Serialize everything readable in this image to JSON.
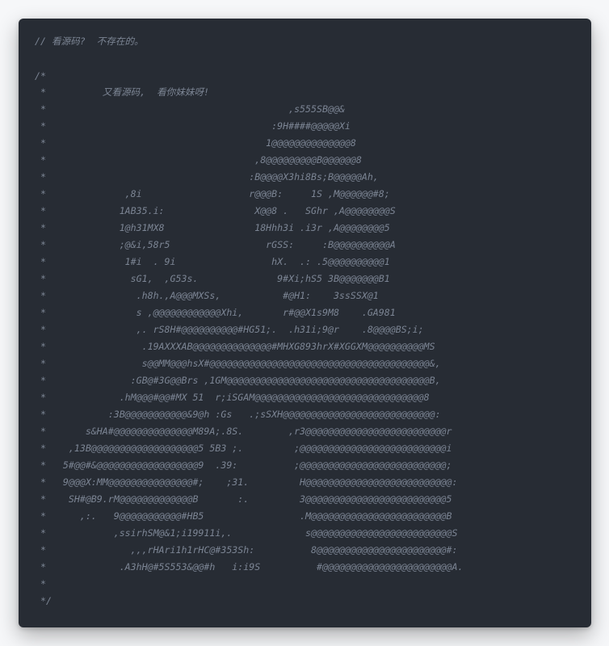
{
  "code": {
    "lines": [
      "// 看源码?  不存在的。",
      "",
      "/*",
      " *          又看源码,  看你妹妹呀!",
      " *                                           ,s555SB@@&",
      " *                                        :9H####@@@@@Xi",
      " *                                       1@@@@@@@@@@@@@@8",
      " *                                     ,8@@@@@@@@@B@@@@@@8",
      " *                                    :B@@@@X3hi8Bs;B@@@@@Ah,",
      " *              ,8i                   r@@@B:     1S ,M@@@@@@#8;",
      " *             1AB35.i:                X@@8 .   SGhr ,A@@@@@@@@S",
      " *             1@h31MX8                18Hhh3i .i3r ,A@@@@@@@@5",
      " *             ;@&i,58r5                 rGSS:     :B@@@@@@@@@@A",
      " *              1#i  . 9i                 hX.  .: .5@@@@@@@@@@1",
      " *               sG1,  ,G53s.              9#Xi;hS5 3B@@@@@@@B1",
      " *                .h8h.,A@@@MXSs,           #@H1:    3ssSSX@1",
      " *                s ,@@@@@@@@@@@@Xhi,       r#@@X1s9M8    .GA981",
      " *                ,. rS8H#@@@@@@@@@@#HG51;.  .h31i;9@r    .8@@@@BS;i;",
      " *                 .19AXXXAB@@@@@@@@@@@@@@#MHXG893hrX#XGGXM@@@@@@@@@@MS",
      " *                 s@@MM@@@hsX#@@@@@@@@@@@@@@@@@@@@@@@@@@@@@@@@@@@@@@@&,",
      " *               :GB@#3G@@Brs ,1GM@@@@@@@@@@@@@@@@@@@@@@@@@@@@@@@@@@@@B,",
      " *             .hM@@@#@@#MX 51  r;iSGAM@@@@@@@@@@@@@@@@@@@@@@@@@@@@@@8",
      " *           :3B@@@@@@@@@@@&9@h :Gs   .;sSXH@@@@@@@@@@@@@@@@@@@@@@@@@@@:",
      " *       s&HA#@@@@@@@@@@@@@@M89A;.8S.        ,r3@@@@@@@@@@@@@@@@@@@@@@@@@r",
      " *    ,13B@@@@@@@@@@@@@@@@@@@5 5B3 ;.         ;@@@@@@@@@@@@@@@@@@@@@@@@@@i",
      " *   5#@@#&@@@@@@@@@@@@@@@@@@9  .39:          ;@@@@@@@@@@@@@@@@@@@@@@@@@@;",
      " *   9@@@X:MM@@@@@@@@@@@@@@@#;    ;31.         H@@@@@@@@@@@@@@@@@@@@@@@@@@:",
      " *    SH#@B9.rM@@@@@@@@@@@@@B       :.         3@@@@@@@@@@@@@@@@@@@@@@@@@5",
      " *      ,:.   9@@@@@@@@@@@#HB5                 .M@@@@@@@@@@@@@@@@@@@@@@@@B",
      " *            ,ssirhSM@&1;i19911i,.             s@@@@@@@@@@@@@@@@@@@@@@@@@S",
      " *               ,,,rHAri1h1rHC@#353Sh:          8@@@@@@@@@@@@@@@@@@@@@@@#:",
      " *             .A3hH@#5S553&@@#h   i:i9S          #@@@@@@@@@@@@@@@@@@@@@@@A.",
      " *",
      " */"
    ]
  },
  "colors": {
    "panel_background": "#272c34",
    "comment_text": "#7c8594",
    "page_background": "#f6f7f9"
  }
}
